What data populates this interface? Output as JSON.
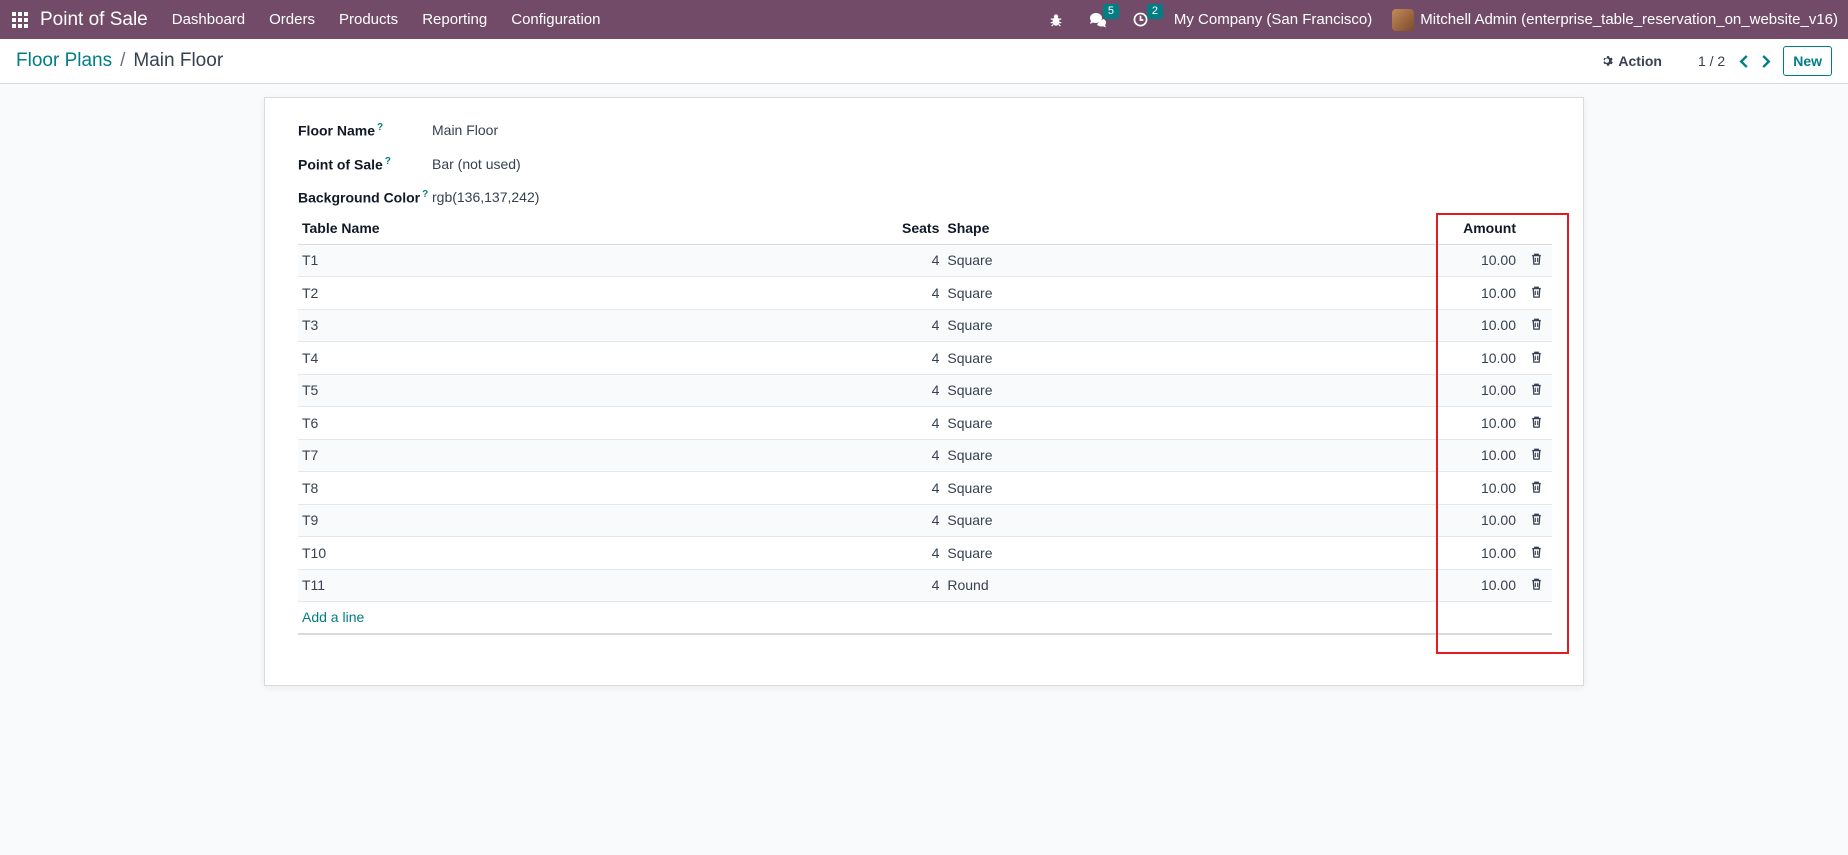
{
  "navbar": {
    "brand": "Point of Sale",
    "menu": [
      "Dashboard",
      "Orders",
      "Products",
      "Reporting",
      "Configuration"
    ],
    "messages_count": "5",
    "activities_count": "2",
    "company": "My Company (San Francisco)",
    "user": "Mitchell Admin (enterprise_table_reservation_on_website_v16)",
    "icons": [
      "apps-grid-icon",
      "bug-icon",
      "chat-icon",
      "clock-icon"
    ]
  },
  "control_panel": {
    "breadcrumb_parent": "Floor Plans",
    "breadcrumb_separator": "/",
    "breadcrumb_current": "Main Floor",
    "action_label": "Action",
    "pager": "1 / 2",
    "new_label": "New"
  },
  "form": {
    "floor_name_label": "Floor Name",
    "floor_name_value": "Main Floor",
    "pos_label": "Point of Sale",
    "pos_value": "Bar (not used)",
    "bg_color_label": "Background Color",
    "bg_color_value": "rgb(136,137,242)",
    "help_mark": "?"
  },
  "table": {
    "headers": {
      "name": "Table Name",
      "seats": "Seats",
      "shape": "Shape",
      "amount": "Amount"
    },
    "rows": [
      {
        "name": "T1",
        "seats": "4",
        "shape": "Square",
        "amount": "10.00"
      },
      {
        "name": "T2",
        "seats": "4",
        "shape": "Square",
        "amount": "10.00"
      },
      {
        "name": "T3",
        "seats": "4",
        "shape": "Square",
        "amount": "10.00"
      },
      {
        "name": "T4",
        "seats": "4",
        "shape": "Square",
        "amount": "10.00"
      },
      {
        "name": "T5",
        "seats": "4",
        "shape": "Square",
        "amount": "10.00"
      },
      {
        "name": "T6",
        "seats": "4",
        "shape": "Square",
        "amount": "10.00"
      },
      {
        "name": "T7",
        "seats": "4",
        "shape": "Square",
        "amount": "10.00"
      },
      {
        "name": "T8",
        "seats": "4",
        "shape": "Square",
        "amount": "10.00"
      },
      {
        "name": "T9",
        "seats": "4",
        "shape": "Square",
        "amount": "10.00"
      },
      {
        "name": "T10",
        "seats": "4",
        "shape": "Square",
        "amount": "10.00"
      },
      {
        "name": "T11",
        "seats": "4",
        "shape": "Round",
        "amount": "10.00"
      }
    ],
    "add_line": "Add a line"
  },
  "colors": {
    "navbar": "#714b67",
    "accent": "#017e84",
    "highlight": "#e11d21"
  }
}
